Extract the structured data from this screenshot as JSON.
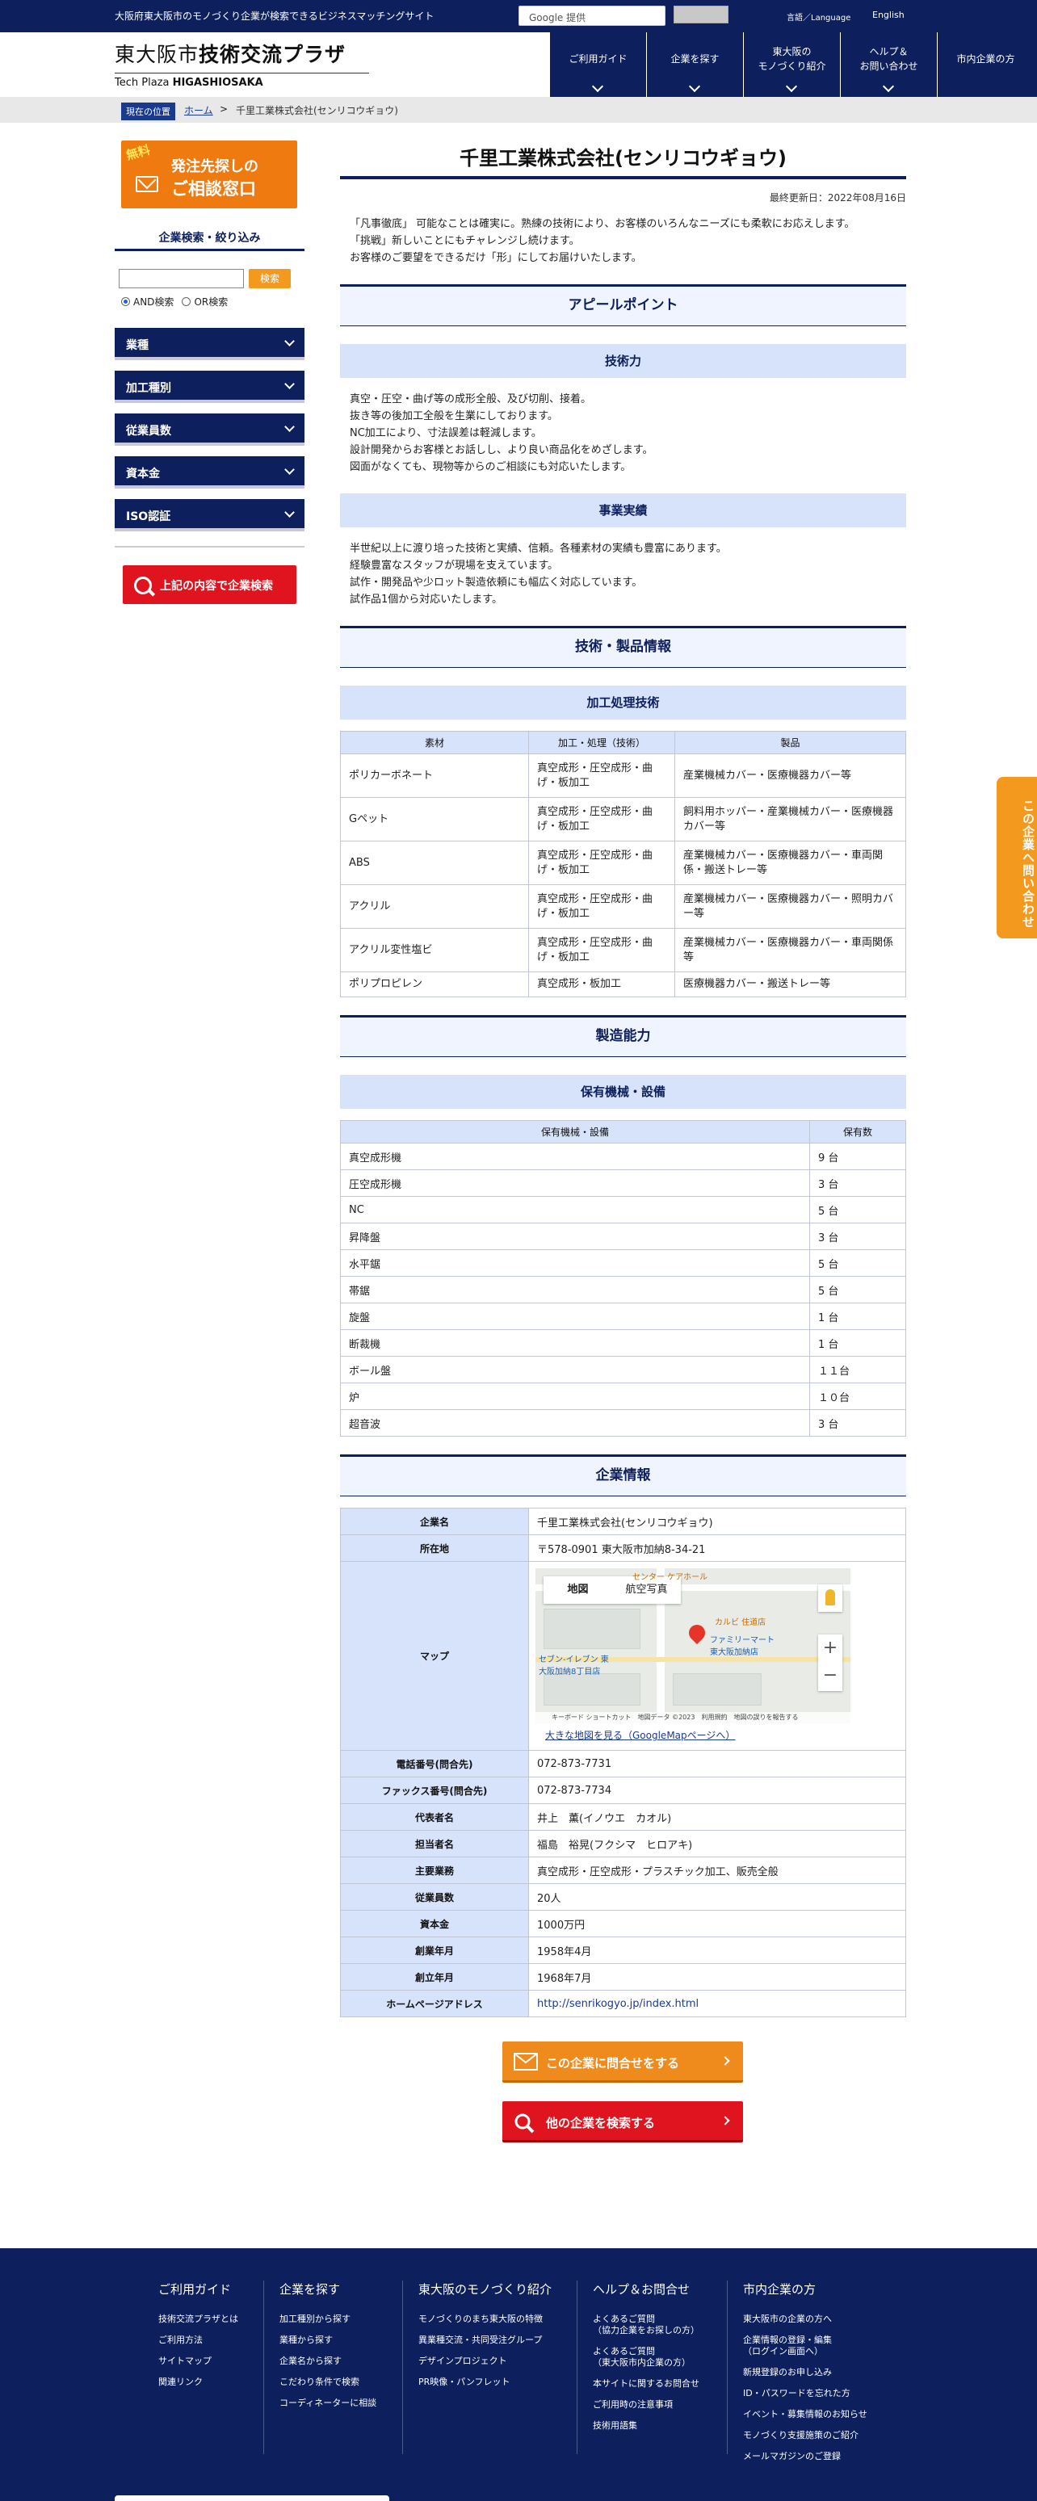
{
  "topbar": {
    "description": "大阪府東大阪市のモノづくり企業が検索できるビジネスマッチングサイト",
    "google_label": "Google 提供",
    "language_label": "言語／Language",
    "english_label": "English"
  },
  "logo": {
    "line1_prefix": "東大阪市",
    "line1_main": "技術交流プラザ",
    "line2_prefix": "Tech Plaza ",
    "line2_main": "HIGASHIOSAKA"
  },
  "nav": [
    {
      "label": "ご利用ガイド"
    },
    {
      "label": "企業を探す"
    },
    {
      "label": "東大阪の\nモノづくり紹介"
    },
    {
      "label": "ヘルプ＆\nお問い合わせ"
    },
    {
      "label": "市内企業の方"
    }
  ],
  "breadcrumb": {
    "here": "現在の位置",
    "home": "ホーム",
    "sep": ">",
    "current": "千里工業株式会社(センリコウギョウ)"
  },
  "sidebar": {
    "consult_free": "無料",
    "consult_line1": "発注先探しの",
    "consult_line2": "ご相談窓口",
    "filter_title": "企業検索・絞り込み",
    "search_button": "検索",
    "and_label": "AND検索",
    "or_label": "OR検索",
    "accordions": [
      "業種",
      "加工種別",
      "従業員数",
      "資本金",
      "ISO認証"
    ],
    "big_search": "上記の内容で企業検索"
  },
  "main": {
    "title": "千里工業株式会社(センリコウギョウ)",
    "updated": "最終更新日：2022年08月16日",
    "intro": "「凡事徹底」 可能なことは確実に。熟練の技術により、お客様のいろんなニーズにも柔軟にお応えします。\n「挑戦」新しいことにもチャレンジし続けます。\nお客様のご要望をできるだけ「形」にしてお届けいたします。",
    "appeal_title": "アピールポイント",
    "tech_title": "技術力",
    "tech_text": "真空・圧空・曲げ等の成形全般、及び切削、接着。\n抜き等の後加工全般を生業にしております。\nNC加工により、寸法誤差は軽減します。\n設計開発からお客様とお話しし、より良い商品化をめざします。\n図面がなくても、現物等からのご相談にも対応いたします。",
    "results_title": "事業実績",
    "results_text": "半世紀以上に渡り培った技術と実績、信頼。各種素材の実績も豊富にあります。\n経験豊富なスタッフが現場を支えています。\n試作・開発品や少ロット製造依頼にも幅広く対応しています。\n試作品1個から対応いたします。",
    "tech_products_title": "技術・製品情報",
    "processing_title": "加工処理技術",
    "processing_headers": [
      "素材",
      "加工・処理（技術）",
      "製品"
    ],
    "processing_rows": [
      [
        "ポリカーボネート",
        "真空成形・圧空成形・曲げ・板加工",
        "産業機械カバー・医療機器カバー等"
      ],
      [
        "Gペット",
        "真空成形・圧空成形・曲げ・板加工",
        "飼料用ホッパー・産業機械カバー・医療機器カバー等"
      ],
      [
        "ABS",
        "真空成形・圧空成形・曲げ・板加工",
        "産業機械カバー・医療機器カバー・車両関係・搬送トレー等"
      ],
      [
        "アクリル",
        "真空成形・圧空成形・曲げ・板加工",
        "産業機械カバー・医療機器カバー・照明カバー等"
      ],
      [
        "アクリル変性塩ビ",
        "真空成形・圧空成形・曲げ・板加工",
        "産業機械カバー・医療機器カバー・車両関係等"
      ],
      [
        "ポリプロピレン",
        "真空成形・板加工",
        "医療機器カバー・搬送トレー等"
      ]
    ],
    "capacity_title": "製造能力",
    "equipment_title": "保有機械・設備",
    "equipment_headers": [
      "保有機械・設備",
      "保有数"
    ],
    "equipment_rows": [
      [
        "真空成形機",
        "9 台"
      ],
      [
        "圧空成形機",
        "3 台"
      ],
      [
        "NC",
        "5 台"
      ],
      [
        "昇降盤",
        "3 台"
      ],
      [
        "水平鋸",
        "5 台"
      ],
      [
        "帯鋸",
        "5 台"
      ],
      [
        "旋盤",
        "1 台"
      ],
      [
        "断裁機",
        "1 台"
      ],
      [
        "ボール盤",
        "１１台"
      ],
      [
        "炉",
        "１０台"
      ],
      [
        "超音波",
        "3 台"
      ]
    ],
    "company_title": "企業情報",
    "company_rows_top": [
      [
        "企業名",
        "千里工業株式会社(センリコウギョウ)"
      ],
      [
        "所在地",
        "〒578-0901 東大阪市加納8-34-21"
      ]
    ],
    "map_label": "マップ",
    "map_tab_map": "地図",
    "map_tab_sat": "航空写真",
    "map_place1": "カルビ 住道店",
    "map_place2": "ファミリーマート\n東大阪加納店",
    "map_place3": "セブン-イレブン 東\n大阪加納8丁目店",
    "map_place4": "センター ケアホール",
    "map_footer": "キーボード ショートカット　地図データ ©2023　利用規約　地図の誤りを報告する",
    "map_link": "大きな地図を見る（GoogleMapページへ）",
    "company_rows_bottom": [
      [
        "電話番号(問合先)",
        "072-873-7731"
      ],
      [
        "ファックス番号(問合先)",
        "072-873-7734"
      ],
      [
        "代表者名",
        "井上　薫(イノウエ　カオル)"
      ],
      [
        "担当者名",
        "福島　裕晃(フクシマ　ヒロアキ)"
      ],
      [
        "主要業務",
        "真空成形・圧空成形・プラスチック加工、販売全般"
      ],
      [
        "従業員数",
        "20人"
      ],
      [
        "資本金",
        "1000万円"
      ],
      [
        "創業年月",
        "1958年4月"
      ],
      [
        "創立年月",
        "1968年7月"
      ]
    ],
    "homepage_label": "ホームページアドレス",
    "homepage_url": "http://senrikogyo.jp/index.html",
    "contact_button": "この企業に問合せをする",
    "other_button": "他の企業を検索する"
  },
  "side_tab": "この企業へ問い合わせ",
  "footer": {
    "columns": [
      {
        "title": "ご利用ガイド",
        "links": [
          "技術交流プラザとは",
          "ご利用方法",
          "サイトマップ",
          "関連リンク"
        ]
      },
      {
        "title": "企業を探す",
        "links": [
          "加工種別から探す",
          "業種から探す",
          "企業名から探す",
          "こだわり条件で検索",
          "コーディネーターに相談"
        ]
      },
      {
        "title": "東大阪のモノづくり紹介",
        "links": [
          "モノづくりのまち東大阪の特徴",
          "異業種交流・共同受注グループ",
          "デザインプロジェクト",
          "PR映像・パンフレット"
        ]
      },
      {
        "title": "ヘルプ＆お問合せ",
        "links": [
          "よくあるご質問\n（協力企業をお探しの方）",
          "よくあるご質問\n（東大阪市内企業の方）",
          "本サイトに関するお問合せ",
          "ご利用時の注意事項",
          "技術用語集"
        ]
      },
      {
        "title": "市内企業の方",
        "links": [
          "東大阪市の企業の方へ",
          "企業情報の登録・編集\n（ログイン画面へ）",
          "新規登録のお申し込み",
          "ID・パスワードを忘れた方",
          "イベント・募集情報のお知らせ",
          "モノづくり支援施策のご紹介",
          "メールマガジンのご登録"
        ]
      }
    ]
  }
}
